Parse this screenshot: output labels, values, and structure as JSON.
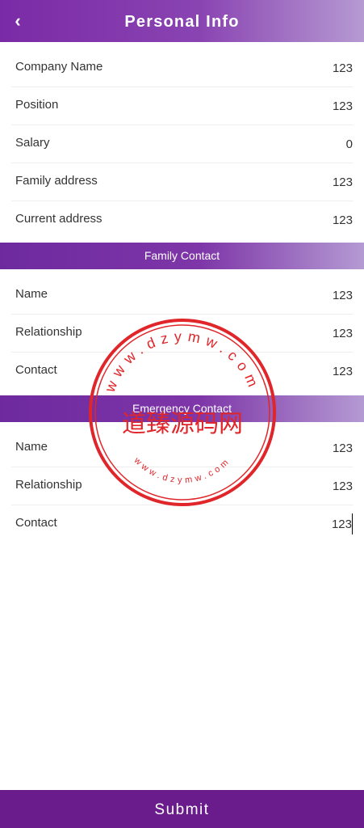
{
  "header": {
    "title": "Personal Info",
    "back_icon": "chevron-left-icon"
  },
  "work": {
    "rows": [
      {
        "label": "Company Name",
        "value": "123"
      },
      {
        "label": "Position",
        "value": "123"
      },
      {
        "label": "Salary",
        "value": "0"
      },
      {
        "label": "Family address",
        "value": "123"
      },
      {
        "label": "Current address",
        "value": "123"
      }
    ]
  },
  "family_contact": {
    "title": "Family Contact",
    "rows": [
      {
        "label": "Name",
        "value": "123"
      },
      {
        "label": "Relationship",
        "value": "123"
      },
      {
        "label": "Contact",
        "value": "123"
      }
    ]
  },
  "emergency_contact": {
    "title": "Emergency Contact",
    "rows": [
      {
        "label": "Name",
        "value": "123"
      },
      {
        "label": "Relationship",
        "value": "123"
      },
      {
        "label": "Contact",
        "value": "123"
      }
    ]
  },
  "submit_label": "Submit",
  "watermark": {
    "main_text": "道臻源码网",
    "ring_text": "www.dzymw.com",
    "color": "#e0262a"
  },
  "colors": {
    "accent": "#7a2aa6",
    "submit_bg": "#6a1b8c"
  }
}
